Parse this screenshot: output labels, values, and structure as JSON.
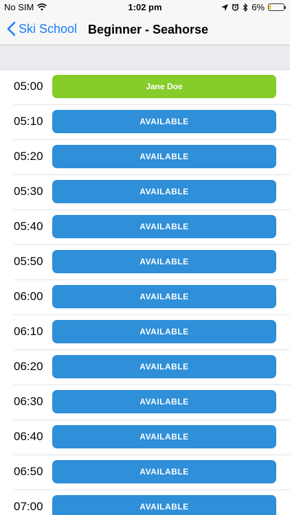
{
  "status_bar": {
    "carrier": "No SIM",
    "time": "1:02 pm",
    "battery_percent": "6%",
    "battery_level": 0.06,
    "icons": [
      "wifi-icon",
      "location-arrow-icon",
      "alarm-icon",
      "bluetooth-icon",
      "battery-icon"
    ]
  },
  "nav": {
    "back_label": "Ski School",
    "title": "Beginner - Seahorse"
  },
  "colors": {
    "accent": "#157efb",
    "available": "#2f8fd8",
    "booked": "#86cc2a"
  },
  "slots": [
    {
      "time": "05:00",
      "label": "Jane Doe",
      "status": "booked"
    },
    {
      "time": "05:10",
      "label": "AVAILABLE",
      "status": "available"
    },
    {
      "time": "05:20",
      "label": "AVAILABLE",
      "status": "available"
    },
    {
      "time": "05:30",
      "label": "AVAILABLE",
      "status": "available"
    },
    {
      "time": "05:40",
      "label": "AVAILABLE",
      "status": "available"
    },
    {
      "time": "05:50",
      "label": "AVAILABLE",
      "status": "available"
    },
    {
      "time": "06:00",
      "label": "AVAILABLE",
      "status": "available"
    },
    {
      "time": "06:10",
      "label": "AVAILABLE",
      "status": "available"
    },
    {
      "time": "06:20",
      "label": "AVAILABLE",
      "status": "available"
    },
    {
      "time": "06:30",
      "label": "AVAILABLE",
      "status": "available"
    },
    {
      "time": "06:40",
      "label": "AVAILABLE",
      "status": "available"
    },
    {
      "time": "06:50",
      "label": "AVAILABLE",
      "status": "available"
    },
    {
      "time": "07:00",
      "label": "AVAILABLE",
      "status": "available"
    }
  ]
}
